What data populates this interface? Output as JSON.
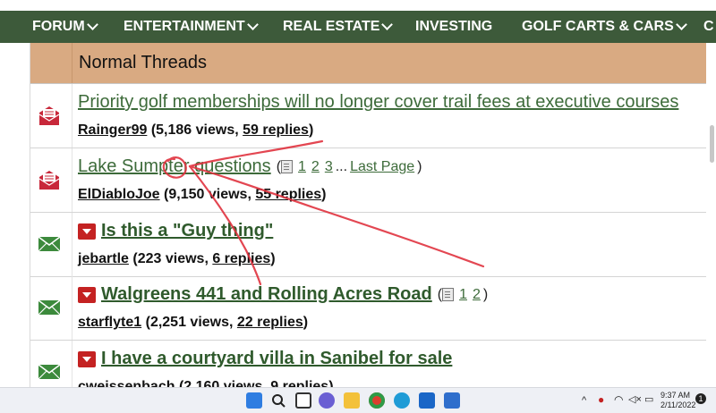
{
  "nav": {
    "items": [
      {
        "label": "FORUM",
        "chevron": true
      },
      {
        "label": "ENTERTAINMENT",
        "chevron": true
      },
      {
        "label": "REAL ESTATE",
        "chevron": true
      },
      {
        "label": "INVESTING",
        "chevron": false
      },
      {
        "label": "GOLF CARTS & CARS",
        "chevron": true
      },
      {
        "label": "C",
        "chevron": false
      }
    ]
  },
  "section": {
    "title": "Normal Threads"
  },
  "threads": [
    {
      "icon": "envelope-open-red-icon",
      "hot": false,
      "title": "Priority golf memberships will no longer cover trail fees at executive courses",
      "pages": [],
      "author": "Rainger99",
      "views": "5,186 views",
      "replies": "59 replies"
    },
    {
      "icon": "envelope-open-red-icon",
      "hot": false,
      "title": "Lake Sumpter questions",
      "pages": [
        "1",
        "2",
        "3"
      ],
      "ellipsis": "...",
      "last_page": "Last Page",
      "author": "ElDiabloJoe",
      "views": "9,150 views",
      "replies": "55 replies"
    },
    {
      "icon": "envelope-green-icon",
      "hot": true,
      "title": "Is this a \"Guy thing\"",
      "pages": [],
      "author": "jebartle",
      "views": "223 views",
      "replies": "6 replies"
    },
    {
      "icon": "envelope-green-icon",
      "hot": true,
      "title": "Walgreens 441 and Rolling Acres Road",
      "pages": [
        "1",
        "2"
      ],
      "author": "starflyte1",
      "views": "2,251 views",
      "replies": "22 replies"
    },
    {
      "icon": "envelope-green-icon",
      "hot": true,
      "title": "I have a courtyard villa in Sanibel for sale",
      "pages": [],
      "author": "cweissenbach",
      "views": "2,160 views",
      "replies": "9 replies"
    }
  ],
  "taskbar": {
    "time": "9:37 AM",
    "date": "2/11/2022",
    "notification_count": "1"
  },
  "colors": {
    "nav_bg": "#3d5a3a",
    "header_bg": "#d9aa82",
    "link_green": "#3d6b3a",
    "annotation_red": "#e0333f"
  }
}
